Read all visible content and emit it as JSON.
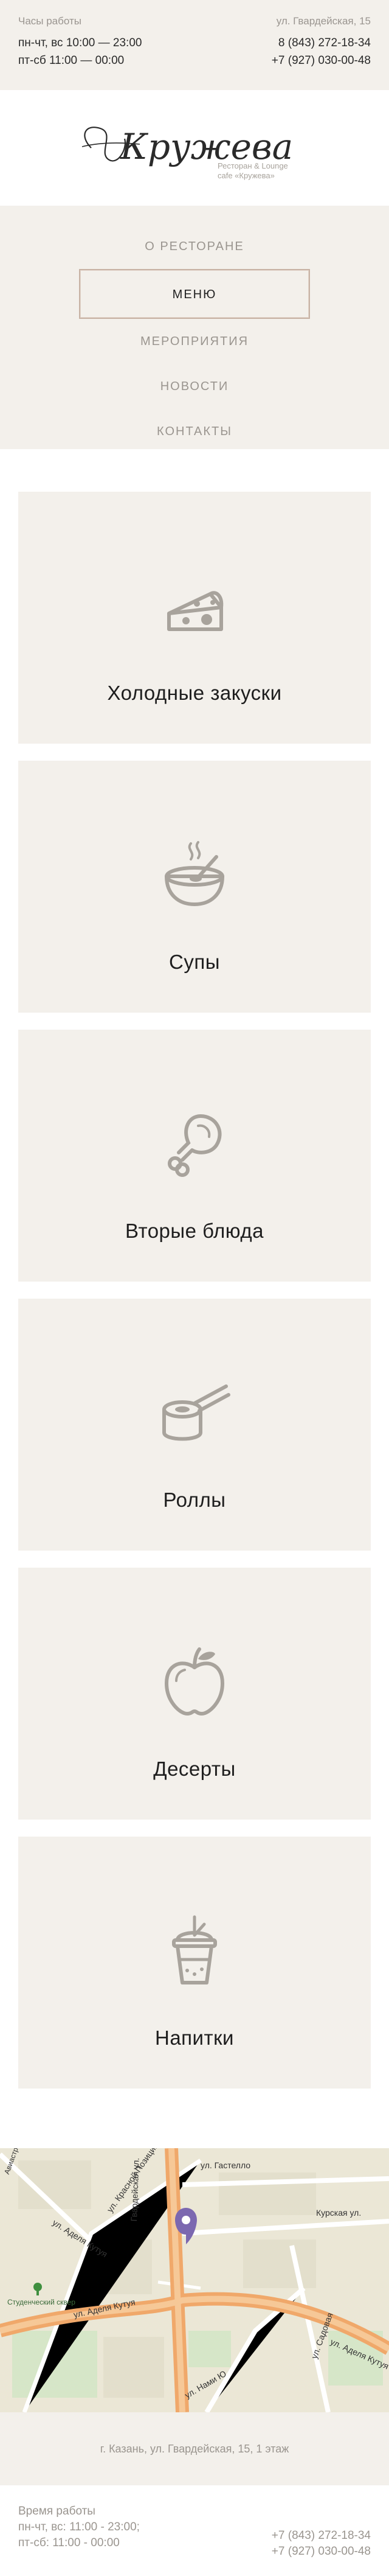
{
  "topbar": {
    "hours_label": "Часы работы",
    "hours_line1": "пн-чт, вс 10:00 — 23:00",
    "hours_line2": "пт-сб 11:00 — 00:00",
    "address": "ул. Гвардейская, 15",
    "phone1": "8 (843) 272-18-34",
    "phone2": "+7 (927) 030-00-48"
  },
  "logo": {
    "script_text": "Кружева",
    "subtitle_line1": "Ресторан & Lounge",
    "subtitle_line2": "cafe «Кружева»"
  },
  "nav": {
    "items": [
      {
        "label": "О РЕСТОРАНЕ"
      },
      {
        "label": "МЕНЮ"
      },
      {
        "label": "МЕРОПРИЯТИЯ"
      },
      {
        "label": "НОВОСТИ"
      },
      {
        "label": "КОНТАКТЫ"
      }
    ]
  },
  "menu": {
    "categories": [
      {
        "title": "Холодные закуски",
        "icon": "cheese-icon"
      },
      {
        "title": "Супы",
        "icon": "soup-bowl-icon"
      },
      {
        "title": "Вторые блюда",
        "icon": "chicken-leg-icon"
      },
      {
        "title": "Роллы",
        "icon": "sushi-roll-icon"
      },
      {
        "title": "Десерты",
        "icon": "apple-icon"
      },
      {
        "title": "Напитки",
        "icon": "drink-cup-icon"
      }
    ]
  },
  "map": {
    "labels": {
      "street_gastello": "ул. Гастелло",
      "street_kurskaya": "Курская ул.",
      "street_gvardeyskaya": "Гвардейская ул.",
      "street_adelya_kutuya": "ул. Аделя Кутуя",
      "street_adelya_kutuya2": "ул. Аделя Кутуя",
      "street_adelya_kutuya3": "ул. Аделя Кутуя",
      "street_krasnoy_pozitsii": "ул. Красной Позиции",
      "street_sadovaya": "ул. Садовая",
      "street_nazhmi": "ул. Нами Ю",
      "park": "Студенческий сквер",
      "street_left": "Авиастроительная"
    }
  },
  "address_line": "г. Казань, ул. Гвардейская, 15, 1 этаж",
  "footer": {
    "hours_label": "Время работы",
    "hours_line1": "пн-чт, вс: 11:00 - 23:00;",
    "hours_line2": "пт-сб: 11:00 - 00:00",
    "phone1": "+7 (843) 272-18-34",
    "phone2": "+7 (927) 030-00-48"
  },
  "colors": {
    "panel_bg": "#f3f0eb",
    "accent_border": "#c8b3a5",
    "map_marker": "#7c68b0",
    "main_road": "#f0a86a"
  }
}
